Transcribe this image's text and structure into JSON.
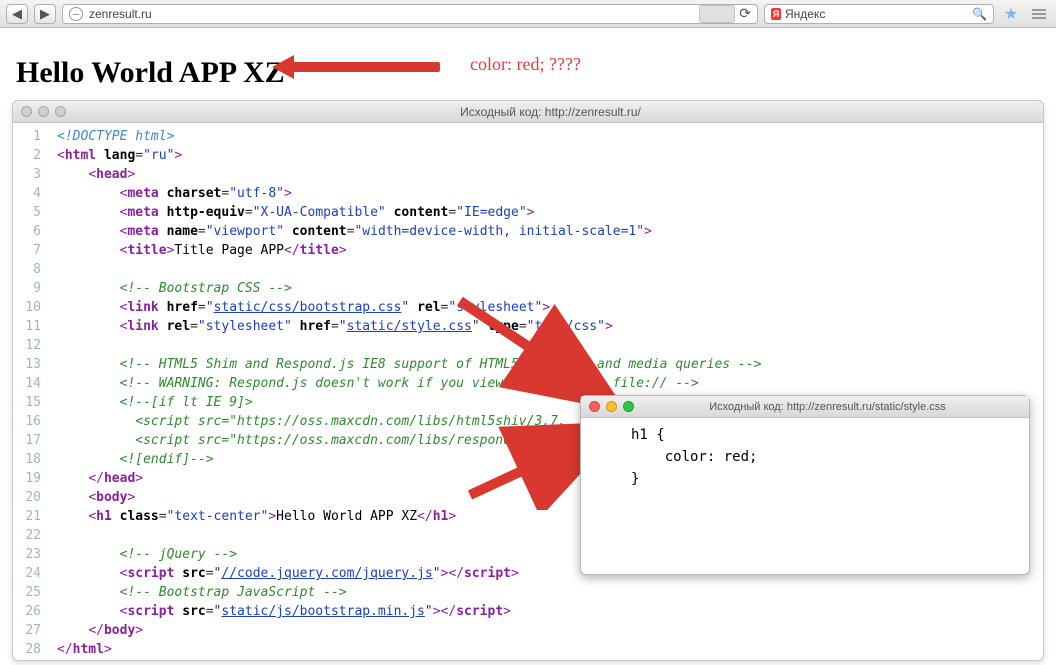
{
  "browser": {
    "url": "zenresult.ru",
    "search_placeholder": "Яндекс"
  },
  "page": {
    "heading": "Hello World APP XZ"
  },
  "annotation": {
    "text": "color: red; ????"
  },
  "source_window": {
    "title": "Исходный код: http://zenresult.ru/",
    "lines": [
      {
        "n": 1,
        "html": "<span class='doctype'>&lt;!DOCTYPE html&gt;</span>"
      },
      {
        "n": 2,
        "html": "<span class='punct'>&lt;</span><span class='tag'>html</span> <span class='attr'>lang</span>=<span class='val'>\"ru\"</span><span class='punct'>&gt;</span>"
      },
      {
        "n": 3,
        "html": "    <span class='punct'>&lt;</span><span class='tag'>head</span><span class='punct'>&gt;</span>"
      },
      {
        "n": 4,
        "html": "        <span class='punct'>&lt;</span><span class='tag'>meta</span> <span class='attr'>charset</span>=<span class='val'>\"utf-8\"</span><span class='punct'>&gt;</span>"
      },
      {
        "n": 5,
        "html": "        <span class='punct'>&lt;</span><span class='tag'>meta</span> <span class='attr'>http-equiv</span>=<span class='val'>\"X-UA-Compatible\"</span> <span class='attr'>content</span>=<span class='val'>\"IE=edge\"</span><span class='punct'>&gt;</span>"
      },
      {
        "n": 6,
        "html": "        <span class='punct'>&lt;</span><span class='tag'>meta</span> <span class='attr'>name</span>=<span class='val'>\"viewport\"</span> <span class='attr'>content</span>=<span class='val'>\"width=device-width, initial-scale=1\"</span><span class='punct'>&gt;</span>"
      },
      {
        "n": 7,
        "html": "        <span class='punct'>&lt;</span><span class='tag'>title</span><span class='punct'>&gt;</span><span class='text'>Title Page APP</span><span class='punct'>&lt;/</span><span class='tag'>title</span><span class='punct'>&gt;</span>"
      },
      {
        "n": 8,
        "html": " "
      },
      {
        "n": 9,
        "html": "        <span class='comment'>&lt;!-- Bootstrap CSS --&gt;</span>"
      },
      {
        "n": 10,
        "html": "        <span class='punct'>&lt;</span><span class='tag'>link</span> <span class='attr'>href</span>=\"<span class='link'>static/css/bootstrap.css</span>\" <span class='attr'>rel</span>=<span class='val'>\"stylesheet\"</span><span class='punct'>&gt;</span>"
      },
      {
        "n": 11,
        "html": "        <span class='punct'>&lt;</span><span class='tag'>link</span> <span class='attr'>rel</span>=<span class='val'>\"stylesheet\"</span> <span class='attr'>href</span>=\"<span class='link'>static/style.css</span>\" <span class='attr'>type</span>=<span class='val'>\"text/css\"</span><span class='punct'>&gt;</span>"
      },
      {
        "n": 12,
        "html": " "
      },
      {
        "n": 13,
        "html": "        <span class='comment'>&lt;!-- HTML5 Shim and Respond.js IE8 support of HTML5 elements and media queries --&gt;</span>"
      },
      {
        "n": 14,
        "html": "        <span class='comment'>&lt;!-- WARNING: Respond.js doesn't work if you view the page via file:// --&gt;</span>"
      },
      {
        "n": 15,
        "html": "        <span class='comment'>&lt;!--[if lt IE 9]&gt;</span>"
      },
      {
        "n": 16,
        "html": "          <span class='comment'>&lt;script src=\"https://oss.maxcdn.com/libs/html5shiv/3.7.</span>"
      },
      {
        "n": 17,
        "html": "          <span class='comment'>&lt;script src=\"https://oss.maxcdn.com/libs/respond.js/1.4</span>"
      },
      {
        "n": 18,
        "html": "        <span class='comment'>&lt;![endif]--&gt;</span>"
      },
      {
        "n": 19,
        "html": "    <span class='punct'>&lt;/</span><span class='tag'>head</span><span class='punct'>&gt;</span>"
      },
      {
        "n": 20,
        "html": "    <span class='punct'>&lt;</span><span class='tag'>body</span><span class='punct'>&gt;</span>"
      },
      {
        "n": 21,
        "html": "    <span class='punct'>&lt;</span><span class='tag'>h1</span> <span class='attr'>class</span>=<span class='val'>\"text-center\"</span><span class='punct'>&gt;</span><span class='text'>Hello World APP XZ</span><span class='punct'>&lt;/</span><span class='tag'>h1</span><span class='punct'>&gt;</span>"
      },
      {
        "n": 22,
        "html": " "
      },
      {
        "n": 23,
        "html": "        <span class='comment'>&lt;!-- jQuery --&gt;</span>"
      },
      {
        "n": 24,
        "html": "        <span class='punct'>&lt;</span><span class='tag'>script</span> <span class='attr'>src</span>=\"<span class='link'>//code.jquery.com/jquery.js</span>\"<span class='punct'>&gt;&lt;/</span><span class='tag'>script</span><span class='punct'>&gt;</span>"
      },
      {
        "n": 25,
        "html": "        <span class='comment'>&lt;!-- Bootstrap JavaScript --&gt;</span>"
      },
      {
        "n": 26,
        "html": "        <span class='punct'>&lt;</span><span class='tag'>script</span> <span class='attr'>src</span>=\"<span class='link'>static/js/bootstrap.min.js</span>\"<span class='punct'>&gt;&lt;/</span><span class='tag'>script</span><span class='punct'>&gt;</span>"
      },
      {
        "n": 27,
        "html": "    <span class='punct'>&lt;/</span><span class='tag'>body</span><span class='punct'>&gt;</span>"
      },
      {
        "n": 28,
        "html": "<span class='punct'>&lt;/</span><span class='tag'>html</span><span class='punct'>&gt;</span>"
      }
    ]
  },
  "css_popup": {
    "title": "Исходный код: http://zenresult.ru/static/style.css",
    "body_line1": "h1 {",
    "body_line2": "    color: red;",
    "body_line3": "}"
  }
}
